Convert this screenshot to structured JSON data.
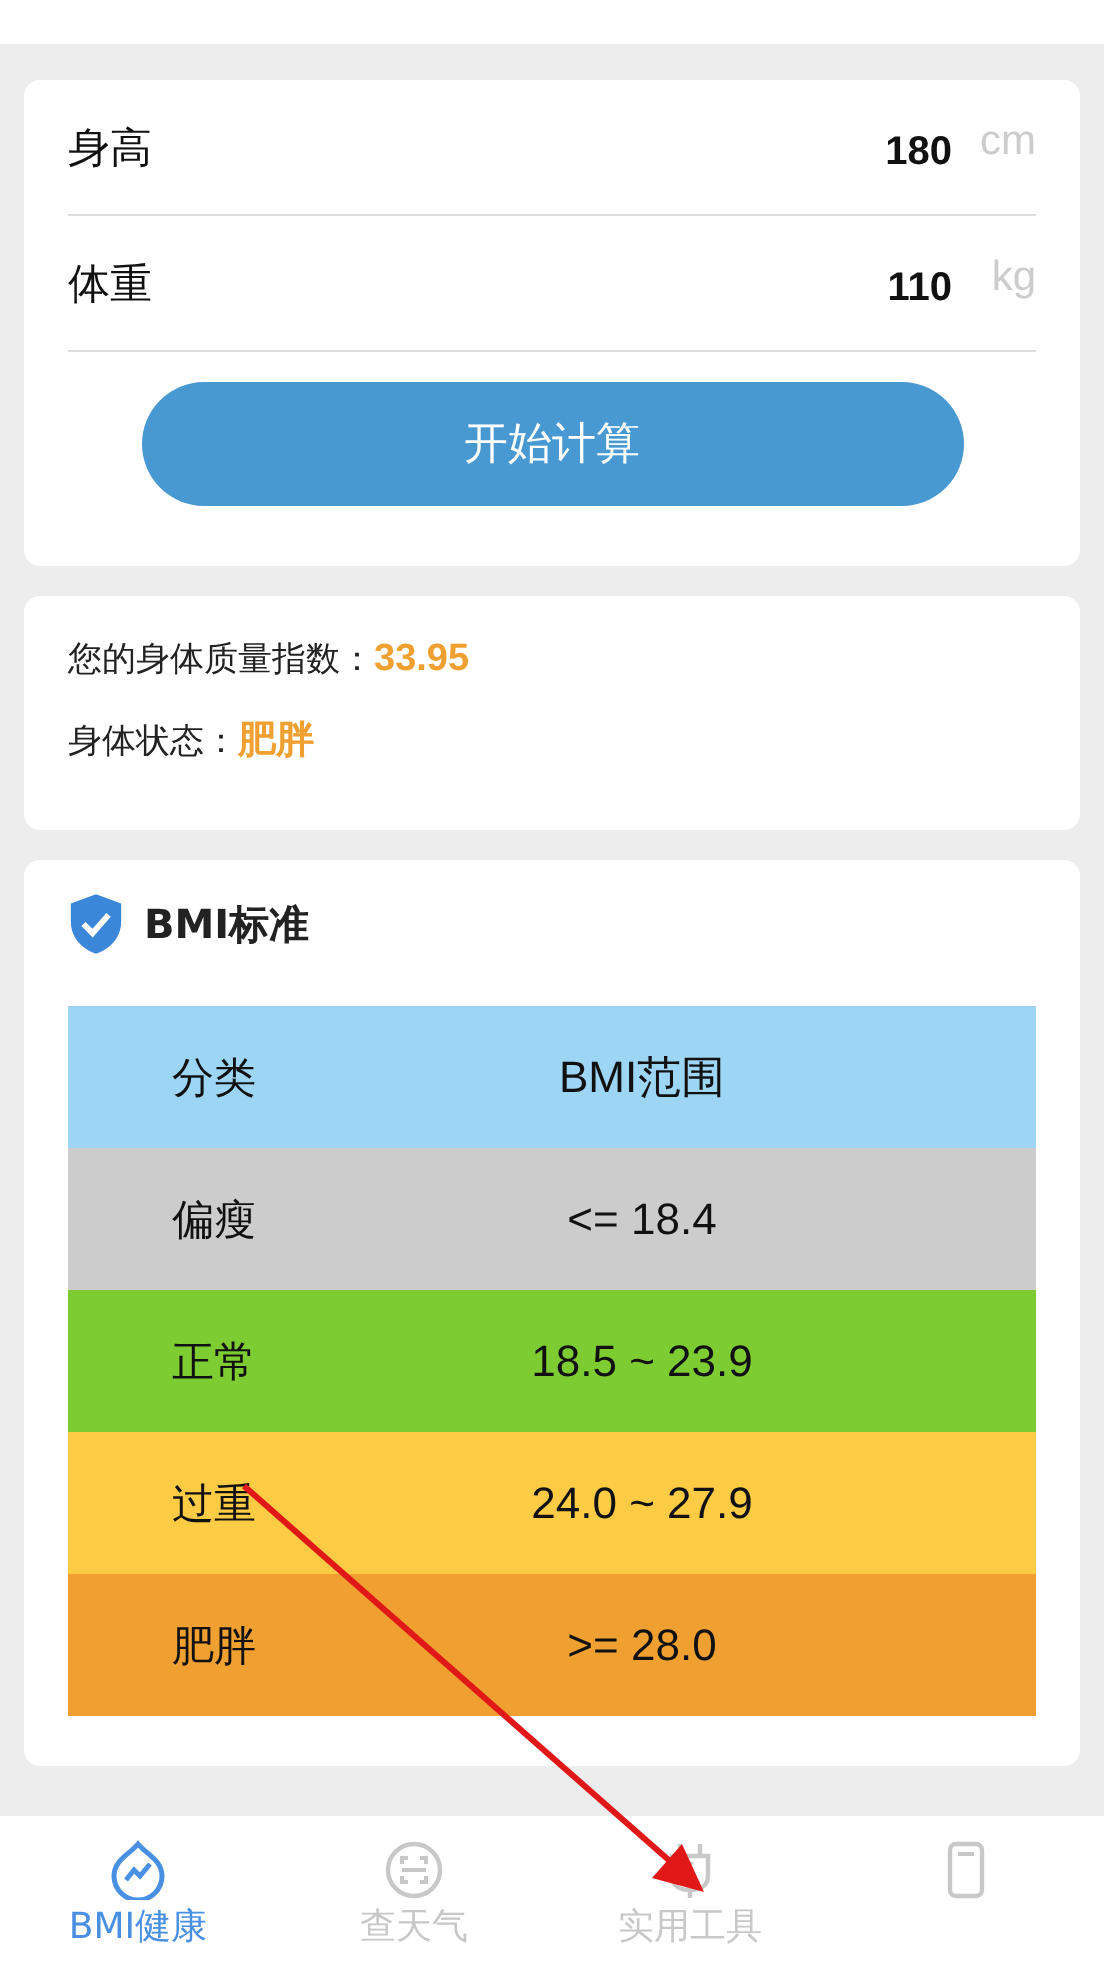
{
  "inputs": [
    {
      "label": "身高",
      "value": "180",
      "unit": "cm"
    },
    {
      "label": "体重",
      "value": "110",
      "unit": "kg"
    }
  ],
  "calculate_button": "开始计算",
  "result": {
    "index_label": "您的身体质量指数：",
    "index_value": "33.95",
    "status_label": "身体状态：",
    "status_value": "肥胖"
  },
  "standard": {
    "title": "BMI标准",
    "columns": [
      "分类",
      "BMI范围"
    ],
    "rows": [
      {
        "category": "偏瘦",
        "range": "<= 18.4",
        "color": "#cccccc"
      },
      {
        "category": "正常",
        "range": "18.5 ~ 23.9",
        "color": "#7dcc32"
      },
      {
        "category": "过重",
        "range": "24.0 ~ 27.9",
        "color": "#fdcc44"
      },
      {
        "category": "肥胖",
        "range": ">= 28.0",
        "color": "#f0a030"
      }
    ]
  },
  "tabs": [
    {
      "label": "BMI健康",
      "kind": "chart",
      "selected": true
    },
    {
      "label": "查天气",
      "kind": "scan",
      "selected": false
    },
    {
      "label": "实用工具",
      "kind": "plug",
      "selected": false
    },
    {
      "kind": "phone",
      "selected": false
    }
  ]
}
